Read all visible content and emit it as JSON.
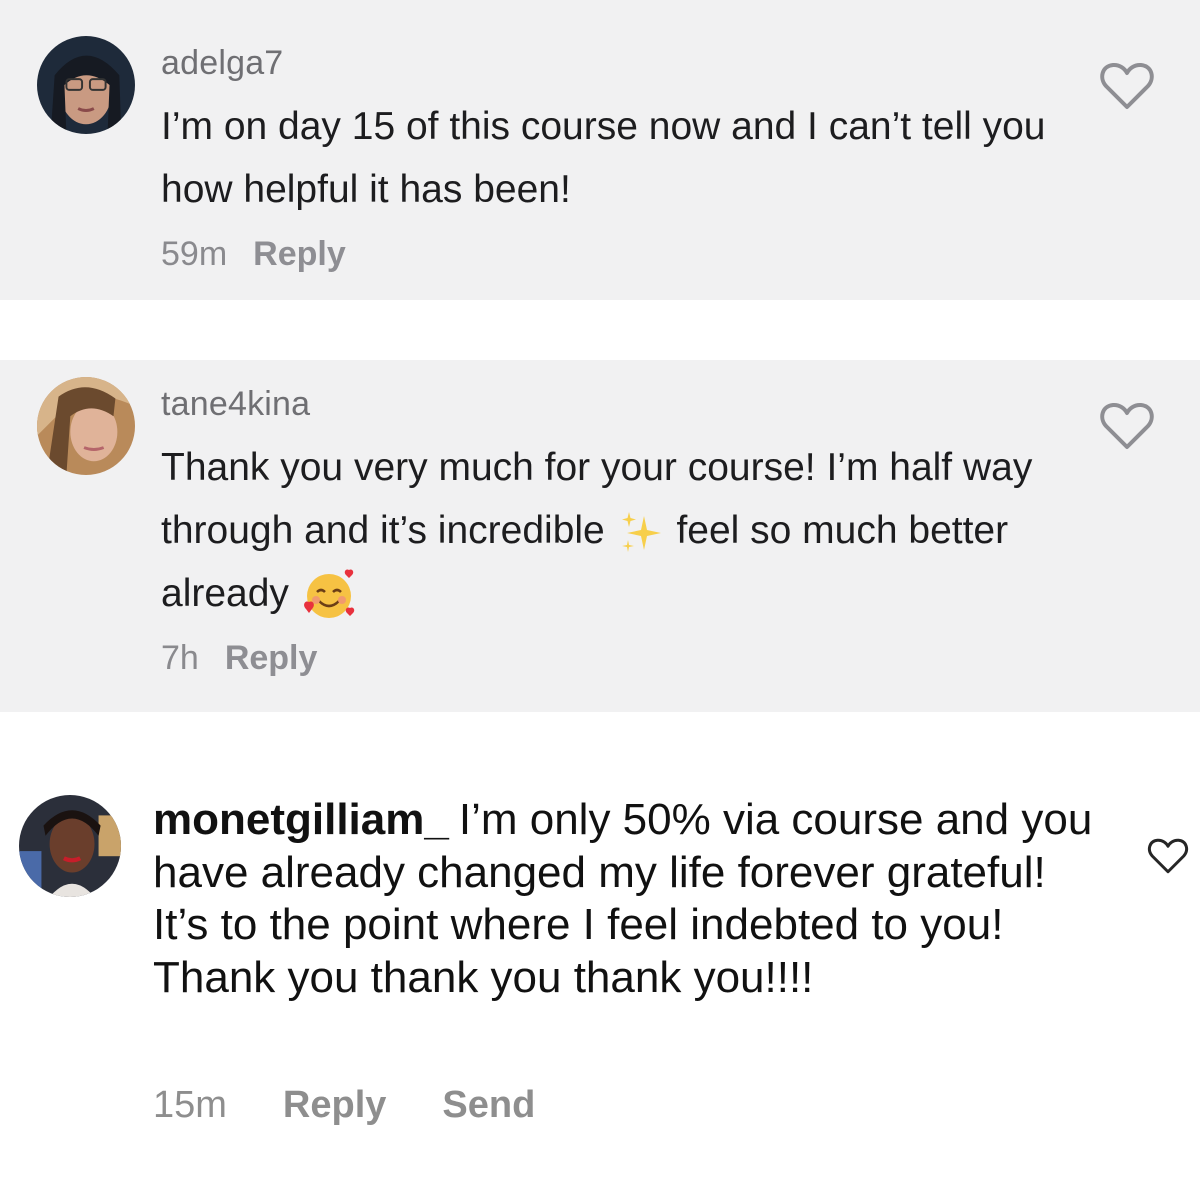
{
  "comments": [
    {
      "username": "adelga7",
      "text": "I’m on day 15 of this course now and I can’t tell you how helpful it has been!",
      "time": "59m",
      "reply_label": "Reply"
    },
    {
      "username": "tane4kina",
      "text_part1": "Thank you very much for your course! I’m half way through and it’s incredible",
      "text_part2": "feel so much better already",
      "time": "7h",
      "reply_label": "Reply"
    },
    {
      "username": "monetgilliam_",
      "text": "I’m only 50% via course and you have already changed my life forever grateful! It’s to the point where I feel indebted to you! Thank you thank you thank you!!!!",
      "time": "15m",
      "reply_label": "Reply",
      "send_label": "Send"
    }
  ],
  "icons": {
    "like": "heart-outline-icon",
    "sparkles": "sparkles-emoji-icon",
    "smile_hearts": "smiling-face-with-hearts-emoji-icon"
  },
  "colors": {
    "card_background": "#f1f1f2",
    "username_gray": "#6f6f73",
    "meta_gray": "#8a8a8e",
    "heart_stroke": "#8e8e93"
  }
}
